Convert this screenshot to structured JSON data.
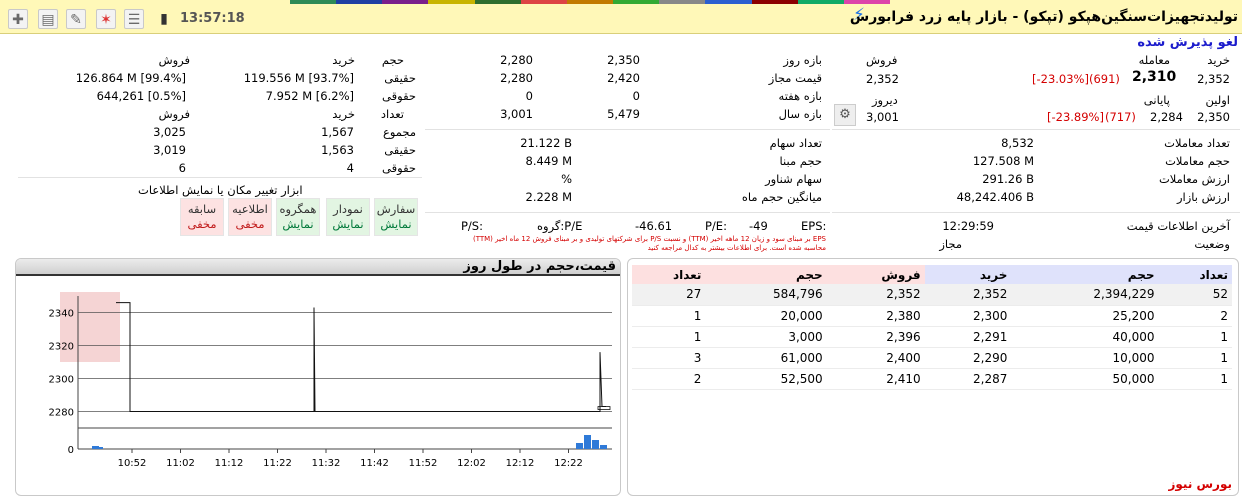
{
  "toolbar": {
    "time": "13:57:18",
    "title": "تولیدتجهیزات‌سنگین‌هپکو (تپکو) - بازار پایه زرد فرابورس",
    "status": "لغو پذیرش شده"
  },
  "colors": {
    "tabs": [
      "#2e8b57",
      "#1f3fa3",
      "#7a1f8c",
      "#c8b400",
      "#2e6e2e",
      "#d44",
      "#c27a00",
      "#3a3",
      "#888",
      "#2b5fd0",
      "#8b0000",
      "#1a6",
      "#d4a"
    ]
  },
  "price": {
    "buy_label": "خرید",
    "trade_label": "معامله",
    "sell_label": "فروش",
    "buy": "2,352",
    "trade": "2,310",
    "trade_change": "(691)",
    "trade_pct": "[-23.03%]",
    "sell": "2,352",
    "first_label": "اولین",
    "close_label": "پایانی",
    "yesterday_label": "دیروز",
    "first": "2,350",
    "close": "2,284",
    "close_change": "(717)",
    "close_pct": "[-23.89%]",
    "yesterday": "3,001"
  },
  "ranges": [
    {
      "label": "بازه روز",
      "a": "2,350",
      "b": "2,280"
    },
    {
      "label": "قیمت مجاز",
      "a": "2,420",
      "b": "2,280"
    },
    {
      "label": "بازه هفته",
      "a": "0",
      "b": "0"
    },
    {
      "label": "بازه سال",
      "a": "5,479",
      "b": "3,001"
    }
  ],
  "legal": {
    "h_vol": "حجم",
    "h_buy": "خرید",
    "h_sell": "فروش",
    "rows": [
      {
        "label": "حقیقی",
        "buy": "119.556 M [93.7%]",
        "sell": "126.864 M [99.4%]"
      },
      {
        "label": "حقوقی",
        "buy": "7.952 M [6.2%]",
        "sell": "644,261 [0.5%]"
      }
    ],
    "h_count": "تعداد",
    "h_buy2": "خرید",
    "h_sell2": "فروش",
    "count_rows": [
      {
        "label": "مجموع",
        "buy": "1,567",
        "sell": "3,025"
      },
      {
        "label": "حقیقی",
        "buy": "1,563",
        "sell": "3,019"
      },
      {
        "label": "حقوقی",
        "buy": "4",
        "sell": "6"
      }
    ]
  },
  "stats_right": [
    {
      "label": "تعداد معاملات",
      "value": "8,532"
    },
    {
      "label": "حجم معاملات",
      "value": "127.508 M"
    },
    {
      "label": "ارزش معاملات",
      "value": "291.26 B"
    },
    {
      "label": "ارزش بازار",
      "value": "48,242.406 B"
    }
  ],
  "stats_mid": [
    {
      "label": "تعداد سهام",
      "value": "21.122 B"
    },
    {
      "label": "حجم مبنا",
      "value": "8.449 M"
    },
    {
      "label": "سهام شناور",
      "value": "%"
    },
    {
      "label": "میانگین حجم ماه",
      "value": "2.228 M"
    }
  ],
  "info": {
    "last_label": "آخرین اطلاعات قیمت",
    "last_time": "12:29:59",
    "state_label": "وضعیت",
    "state_value": "مجاز",
    "eps_label": "EPS:",
    "eps": "-49",
    "pe_label": "P/E:",
    "pe": "-46.61",
    "gpe_label": "گروه:P/E",
    "ps_label": "P/S:",
    "note1": "EPS بر مبنای سود و زیان 12 ماهه اخیر (TTM) و نسبت P/S برای شرکتهای تولیدی و بر مبنای فروش 12 ماه اخیر (TTM)",
    "note2": "محاسبه شده است. برای اطلاعات بیشتر به کدال مراجعه کنید"
  },
  "tools": {
    "title": "ابزار تغییر مکان یا نمایش اطلاعات",
    "buttons": [
      {
        "top": "سفارش",
        "bottom": "نمایش",
        "on": true
      },
      {
        "top": "نمودار",
        "bottom": "نمایش",
        "on": true
      },
      {
        "top": "همگروه",
        "bottom": "نمایش",
        "on": true
      },
      {
        "top": "اطلاعیه",
        "bottom": "مخفی",
        "on": false
      },
      {
        "top": "سابقه",
        "bottom": "مخفی",
        "on": false
      }
    ]
  },
  "chart_title": "قیمت،حجم در طول روز",
  "chart_data": {
    "type": "line",
    "title": "قیمت،حجم در طول روز",
    "x_ticks": [
      "10:52",
      "11:02",
      "11:12",
      "11:22",
      "11:32",
      "11:42",
      "11:52",
      "12:02",
      "12:12",
      "12:22"
    ],
    "y_ticks": [
      2280,
      2300,
      2320,
      2340
    ],
    "ylim": [
      2270,
      2350
    ],
    "volume_axis_ticks": [
      0
    ],
    "grid": true
  },
  "orderbook": {
    "headers": [
      "تعداد",
      "حجم",
      "خرید",
      "فروش",
      "حجم",
      "تعداد"
    ],
    "rows": [
      [
        "52",
        "2,394,229",
        "2,352",
        "2,352",
        "584,796",
        "27"
      ],
      [
        "2",
        "25,200",
        "2,300",
        "2,380",
        "20,000",
        "1"
      ],
      [
        "1",
        "40,000",
        "2,291",
        "2,396",
        "3,000",
        "1"
      ],
      [
        "1",
        "10,000",
        "2,290",
        "2,400",
        "61,000",
        "3"
      ],
      [
        "1",
        "50,000",
        "2,287",
        "2,410",
        "52,500",
        "2"
      ]
    ]
  },
  "brand": "بورس نیوز"
}
